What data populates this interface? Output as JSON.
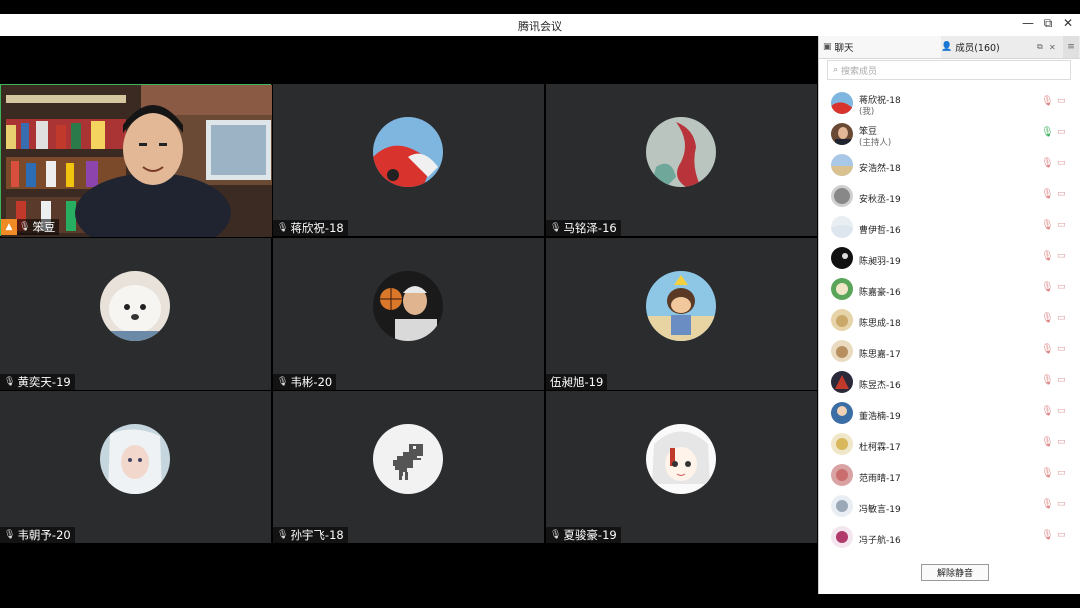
{
  "window": {
    "title": "腾讯会议",
    "minimize_label": "—",
    "restore_label": "⧉",
    "close_label": "✕"
  },
  "grid": {
    "tiles": [
      {
        "name": "笨豆",
        "mic": "🎙",
        "host_badge": "▲",
        "is_video": true,
        "avatar": "video-feed"
      },
      {
        "name": "蒋欣祝-18",
        "mic": "🎙",
        "avatar": "red-car-avatar"
      },
      {
        "name": "马铭泽-16",
        "mic": "🎙",
        "avatar": "red-bird-avatar"
      },
      {
        "name": "黄奕天-19",
        "mic": "🎙",
        "avatar": "white-dog-avatar"
      },
      {
        "name": "韦彬-20",
        "mic": "🎙",
        "avatar": "basketball-person-avatar"
      },
      {
        "name": "伍昶旭-19",
        "mic": "",
        "avatar": "cartoon-boy-avatar"
      },
      {
        "name": "韦朝予-20",
        "mic": "🎙",
        "avatar": "anime-girl-avatar"
      },
      {
        "name": "孙宇飞-18",
        "mic": "🎙",
        "avatar": "dinosaur-avatar"
      },
      {
        "name": "夏骏豪-19",
        "mic": "🎙",
        "avatar": "anime-white-hair-avatar"
      }
    ]
  },
  "sidebar": {
    "tab_chat": "聊天",
    "tab_members": "成员(160)",
    "tab_popout": "⧉",
    "tab_close": "✕",
    "tab_menu": "≡",
    "search_placeholder": "搜索成员",
    "members": [
      {
        "name": "蒋欣祝-18",
        "role": "(我)",
        "mic_on": false
      },
      {
        "name": "笨豆",
        "role": "(主持人)",
        "mic_on": true
      },
      {
        "name": "安浩然-18",
        "role": "",
        "mic_on": false
      },
      {
        "name": "安秋丞-19",
        "role": "",
        "mic_on": false
      },
      {
        "name": "曹伊哲-16",
        "role": "",
        "mic_on": false
      },
      {
        "name": "陈昶羽-19",
        "role": "",
        "mic_on": false
      },
      {
        "name": "陈嘉豪-16",
        "role": "",
        "mic_on": false
      },
      {
        "name": "陈思成-18",
        "role": "",
        "mic_on": false
      },
      {
        "name": "陈思嘉-17",
        "role": "",
        "mic_on": false
      },
      {
        "name": "陈昱杰-16",
        "role": "",
        "mic_on": false
      },
      {
        "name": "董浩楠-19",
        "role": "",
        "mic_on": false
      },
      {
        "name": "杜柯霖-17",
        "role": "",
        "mic_on": false
      },
      {
        "name": "范雨晴-17",
        "role": "",
        "mic_on": false
      },
      {
        "name": "冯敏言-19",
        "role": "",
        "mic_on": false
      },
      {
        "name": "冯子航-16",
        "role": "",
        "mic_on": false
      }
    ],
    "unmute_button": "解除静音"
  },
  "colors": {
    "tile_bg": "#2b2c2e",
    "host_badge": "#f08a24",
    "active_border": "#3db35a"
  }
}
